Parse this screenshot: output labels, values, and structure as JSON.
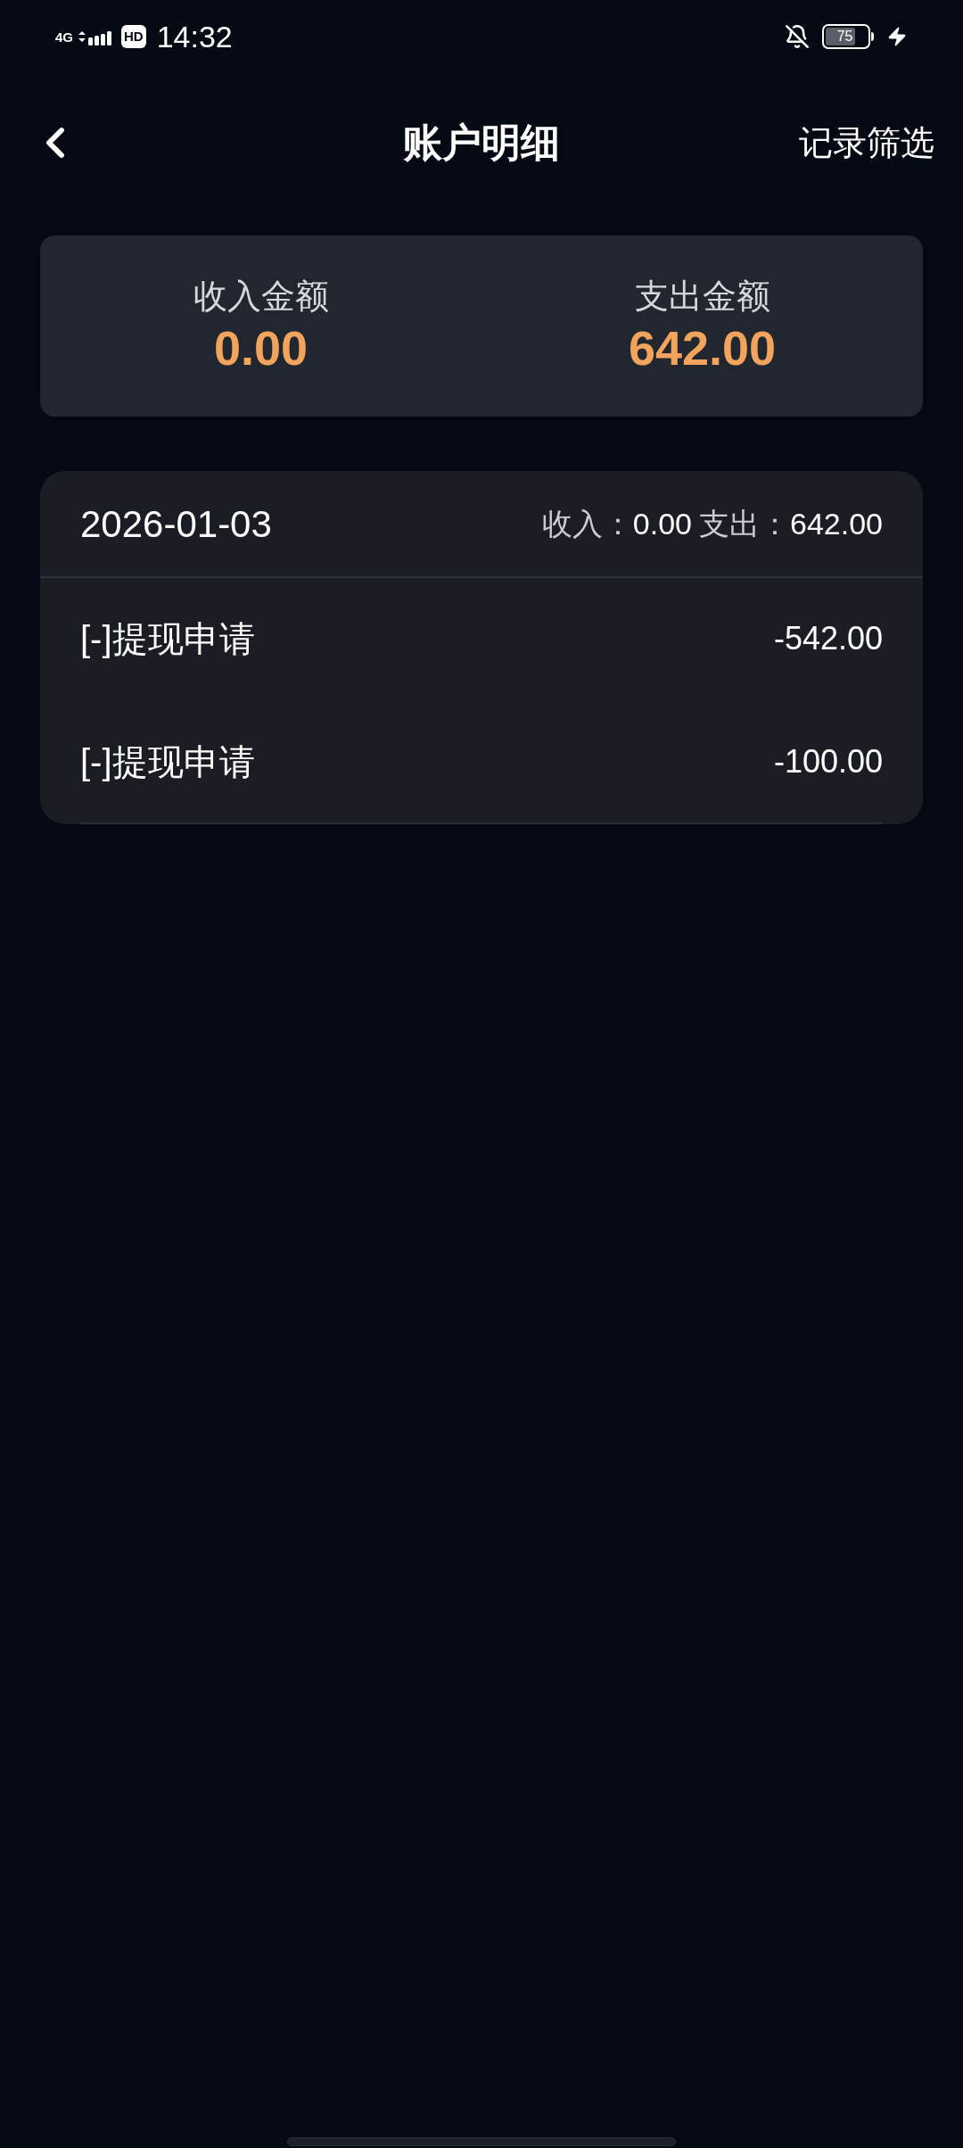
{
  "status_bar": {
    "network": "4G",
    "hd": "HD",
    "time": "14:32",
    "battery": "75"
  },
  "header": {
    "title": "账户明细",
    "action": "记录筛选"
  },
  "summary": [
    {
      "label": "收入金额",
      "amount": "0.00"
    },
    {
      "label": "支出金额",
      "amount": "642.00"
    }
  ],
  "day_groups": [
    {
      "date": "2026-01-03",
      "income_label": "收入：",
      "income": "0.00",
      "expense_label": "支出：",
      "expense": "642.00",
      "records": [
        {
          "title": "[-]提现申请",
          "amount": "-542.00"
        },
        {
          "title": "[-]提现申请",
          "amount": "-100.00"
        }
      ]
    }
  ]
}
